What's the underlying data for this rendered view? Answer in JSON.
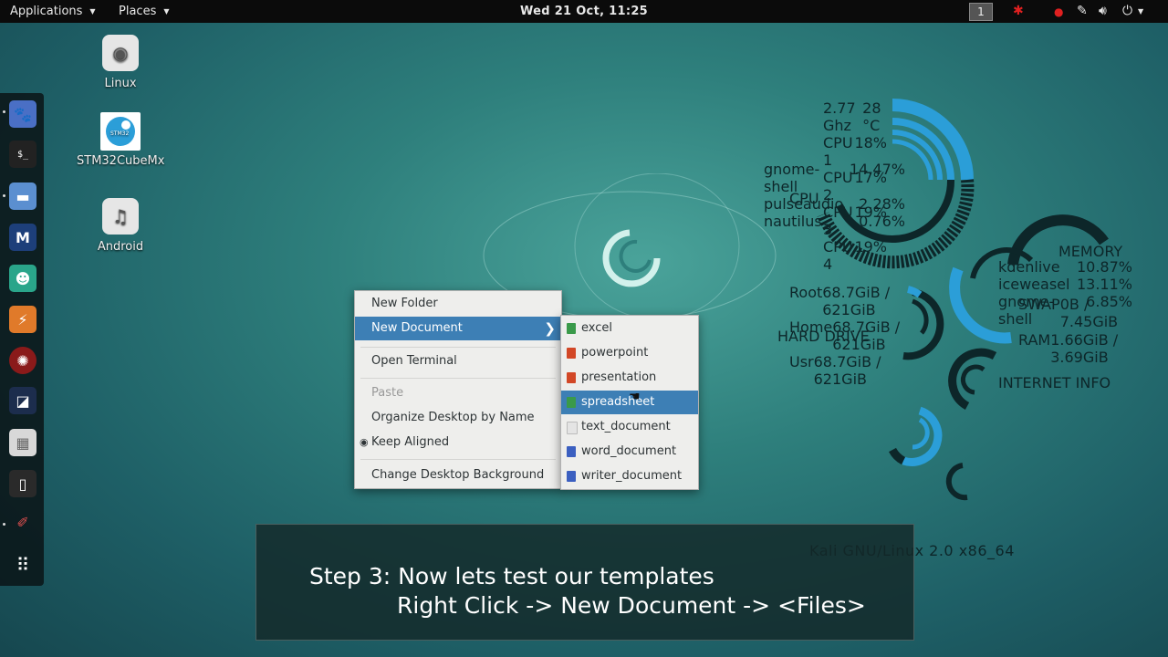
{
  "topbar": {
    "applications": "Applications",
    "places": "Places",
    "clock": "Wed 21 Oct, 11:25",
    "workspace": "1"
  },
  "desktop_icons": [
    {
      "label": "Linux",
      "icon": "disk-icon"
    },
    {
      "label": "STM32CubeMx",
      "icon": "stm32-icon"
    },
    {
      "label": "Android",
      "icon": "music-icon"
    }
  ],
  "context_menu": {
    "new_folder": "New Folder",
    "new_document": "New Document",
    "open_terminal": "Open Terminal",
    "paste": "Paste",
    "organize": "Organize Desktop by Name",
    "keep_aligned": "Keep Aligned",
    "change_bg": "Change Desktop Background"
  },
  "submenu": {
    "items": [
      {
        "label": "excel",
        "color": "#3a9a4a"
      },
      {
        "label": "powerpoint",
        "color": "#d24726"
      },
      {
        "label": "presentation",
        "color": "#d24726"
      },
      {
        "label": "spreadsheet",
        "color": "#3a9a4a"
      },
      {
        "label": "text_document",
        "color": "#bdbdbd"
      },
      {
        "label": "word_document",
        "color": "#3b5fc0"
      },
      {
        "label": "writer_document",
        "color": "#3b5fc0"
      }
    ],
    "selected_index": 3
  },
  "conky": {
    "cpu_title": "CPU",
    "cpu_lines": [
      [
        "2.77 Ghz",
        "28 °C"
      ],
      [
        "CPU 1",
        "18%"
      ],
      [
        "CPU 2",
        "17%"
      ],
      [
        "CPU 3",
        "19%"
      ],
      [
        "CPU 4",
        "19%"
      ]
    ],
    "proc_lines": [
      [
        "gnome-shell",
        "14.47%"
      ],
      [
        "pulseaudio",
        "2.28%"
      ],
      [
        "nautilus",
        "0.76%"
      ]
    ],
    "memory_title": "MEMORY",
    "mem_procs": [
      [
        "kdenlive",
        "10.87%"
      ],
      [
        "iceweasel",
        "13.11%"
      ],
      [
        "gnome-shell",
        "6.85%"
      ]
    ],
    "swap_label": "SWAP",
    "swap_value": "0B  / 7.45GiB",
    "ram_label": "RAM",
    "ram_value": "1.66GiB / 3.69GiB",
    "hd_title": "HARD DRIVE",
    "hd_lines": [
      [
        "Root",
        "68.7GiB / 621GiB"
      ],
      [
        "Home",
        "68.7GiB / 621GiB"
      ],
      [
        "Usr",
        "68.7GiB / 621GiB"
      ]
    ],
    "net_title": "INTERNET INFO",
    "os_line": "Kali GNU/Linux 2.0 x86_64"
  },
  "caption": {
    "line1": "Step 3: Now lets test our templates",
    "line2": "Right Click -> New Document -> <Files>"
  },
  "colors": {
    "accent": "#3d7fb5",
    "ring": "#2b9ed8"
  }
}
